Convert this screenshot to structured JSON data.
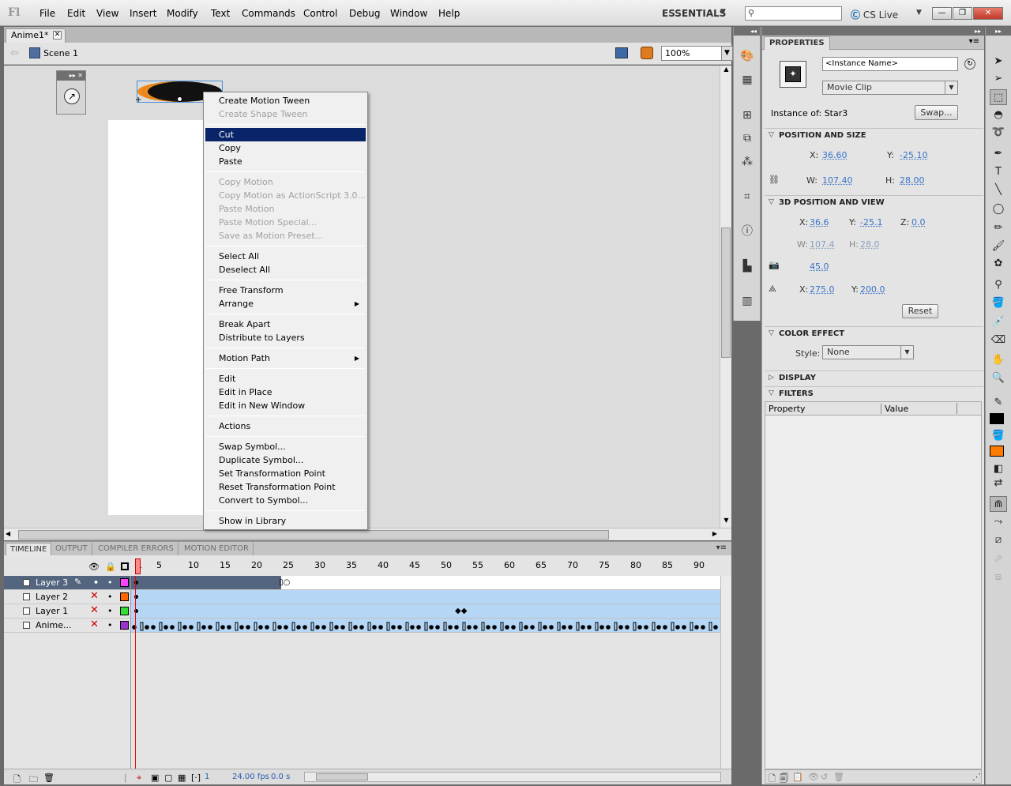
{
  "menubar": {
    "logo": "Fl",
    "items": [
      "File",
      "Edit",
      "View",
      "Insert",
      "Modify",
      "Text",
      "Commands",
      "Control",
      "Debug",
      "Window",
      "Help"
    ],
    "workspace": "ESSENTIALS",
    "cslive": "CS Live",
    "search_placeholder": ""
  },
  "document": {
    "tab": "Anime1*",
    "scene": "Scene 1",
    "zoom": "100%"
  },
  "context_menu": {
    "items": [
      {
        "label": "Create Motion Tween",
        "disabled": false
      },
      {
        "label": "Create Shape Tween",
        "disabled": true
      },
      {
        "label": "Cut",
        "highlight": true
      },
      {
        "label": "Copy"
      },
      {
        "label": "Paste"
      },
      {
        "label": "Copy Motion",
        "disabled": true
      },
      {
        "label": "Copy Motion as ActionScript 3.0...",
        "disabled": true
      },
      {
        "label": "Paste Motion",
        "disabled": true
      },
      {
        "label": "Paste Motion Special...",
        "disabled": true
      },
      {
        "label": "Save as Motion Preset...",
        "disabled": true
      },
      {
        "label": "Select All"
      },
      {
        "label": "Deselect All"
      },
      {
        "label": "Free Transform"
      },
      {
        "label": "Arrange",
        "submenu": true
      },
      {
        "label": "Break Apart"
      },
      {
        "label": "Distribute to Layers"
      },
      {
        "label": "Motion Path",
        "submenu": true
      },
      {
        "label": "Edit"
      },
      {
        "label": "Edit in Place"
      },
      {
        "label": "Edit in New Window"
      },
      {
        "label": "Actions"
      },
      {
        "label": "Swap Symbol..."
      },
      {
        "label": "Duplicate Symbol..."
      },
      {
        "label": "Set Transformation Point"
      },
      {
        "label": "Reset Transformation Point"
      },
      {
        "label": "Convert to Symbol..."
      },
      {
        "label": "Show in Library"
      }
    ]
  },
  "timeline": {
    "tabs": [
      "TIMELINE",
      "OUTPUT",
      "COMPILER ERRORS",
      "MOTION EDITOR"
    ],
    "ruler": [
      "1",
      "5",
      "10",
      "15",
      "20",
      "25",
      "30",
      "35",
      "40",
      "45",
      "50",
      "55",
      "60",
      "65",
      "70",
      "75",
      "80",
      "85",
      "90"
    ],
    "layers": [
      {
        "name": "Layer 3",
        "color": "#ff44ff"
      },
      {
        "name": "Layer 2",
        "color": "#ff6600"
      },
      {
        "name": "Layer 1",
        "color": "#33dd33"
      },
      {
        "name": "Anime...",
        "color": "#9933cc"
      }
    ],
    "footer": {
      "frame": "1",
      "fps": "24.00 fps",
      "time": "0.0 s"
    }
  },
  "properties": {
    "tab": "PROPERTIES",
    "instance_name_placeholder": "<Instance Name>",
    "type": "Movie Clip",
    "instance_of_label": "Instance of:",
    "instance_of_value": "Star3",
    "swap_label": "Swap...",
    "position_and_size": {
      "title": "POSITION AND SIZE",
      "x_label": "X:",
      "x": "36.60",
      "y_label": "Y:",
      "y": "-25.10",
      "w_label": "W:",
      "w": "107.40",
      "h_label": "H:",
      "h": "28.00"
    },
    "pos3d": {
      "title": "3D POSITION AND VIEW",
      "x_label": "X:",
      "x": "36.6",
      "y_label": "Y:",
      "y": "-25.1",
      "z_label": "Z:",
      "z": "0.0",
      "w_label": "W:",
      "w": "107.4",
      "h_label": "H:",
      "h": "28.0",
      "perspective": "45.0",
      "vx_label": "X:",
      "vx": "275.0",
      "vy_label": "Y:",
      "vy": "200.0",
      "reset_label": "Reset"
    },
    "color_effect": {
      "title": "COLOR EFFECT",
      "style_label": "Style:",
      "style_value": "None"
    },
    "display": {
      "title": "DISPLAY"
    },
    "filters": {
      "title": "FILTERS",
      "col_property": "Property",
      "col_value": "Value"
    }
  },
  "colors": {
    "stroke_orange": "#f08a1d",
    "fill_color": "#000000",
    "tool_fill_orange": "#ff7a00",
    "menu_highlight": "#0a246a",
    "selected_layer": "#53657f",
    "frame_blue": "#b5d6f5"
  }
}
